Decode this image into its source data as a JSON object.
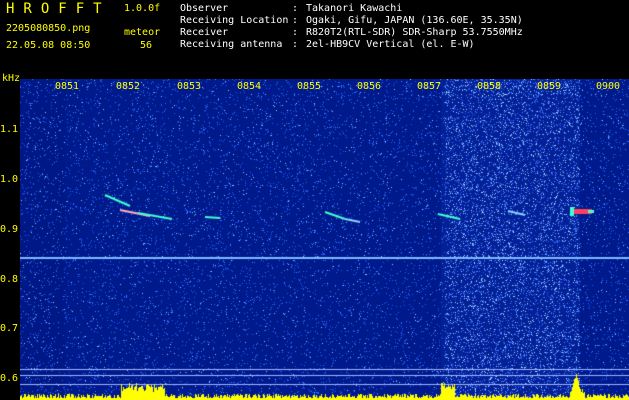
{
  "header": {
    "app_title": "HROFFT",
    "version": "1.0.0f",
    "file_name": "2205080850.png",
    "timestamp": "22.05.08 08:50",
    "meteor_label": "meteor",
    "meteor_count": "56",
    "info": [
      {
        "key": "Observer",
        "sep": ":",
        "value": "Takanori Kawachi"
      },
      {
        "key": "Receiving Location",
        "sep": ":",
        "value": "Ogaki, Gifu, JAPAN (136.60E, 35.35N)"
      },
      {
        "key": "Receiver",
        "sep": ":",
        "value": "R820T2(RTL-SDR) SDR-Sharp 53.7550MHz"
      },
      {
        "key": "Receiving antenna",
        "sep": ":",
        "value": "2el-HB9CV Vertical (el. E-W)"
      }
    ]
  },
  "axes": {
    "y_unit": "kHz",
    "y_ticks": [
      "1.1",
      "1.0",
      "0.9",
      "0.8",
      "0.7",
      "0.6"
    ],
    "x_ticks": [
      "0851",
      "0852",
      "0853",
      "0854",
      "0855",
      "0856",
      "0857",
      "0858",
      "0859",
      "0900"
    ]
  },
  "colors": {
    "background": "#000000",
    "spectrum_base": "#001a8c",
    "noise": "#1f5cff",
    "signal": "#40ffd0",
    "carrier": "#7fb8ff",
    "histogram": "#ffff00",
    "header_text": "#ffff00",
    "info_text": "#ffffff"
  }
}
